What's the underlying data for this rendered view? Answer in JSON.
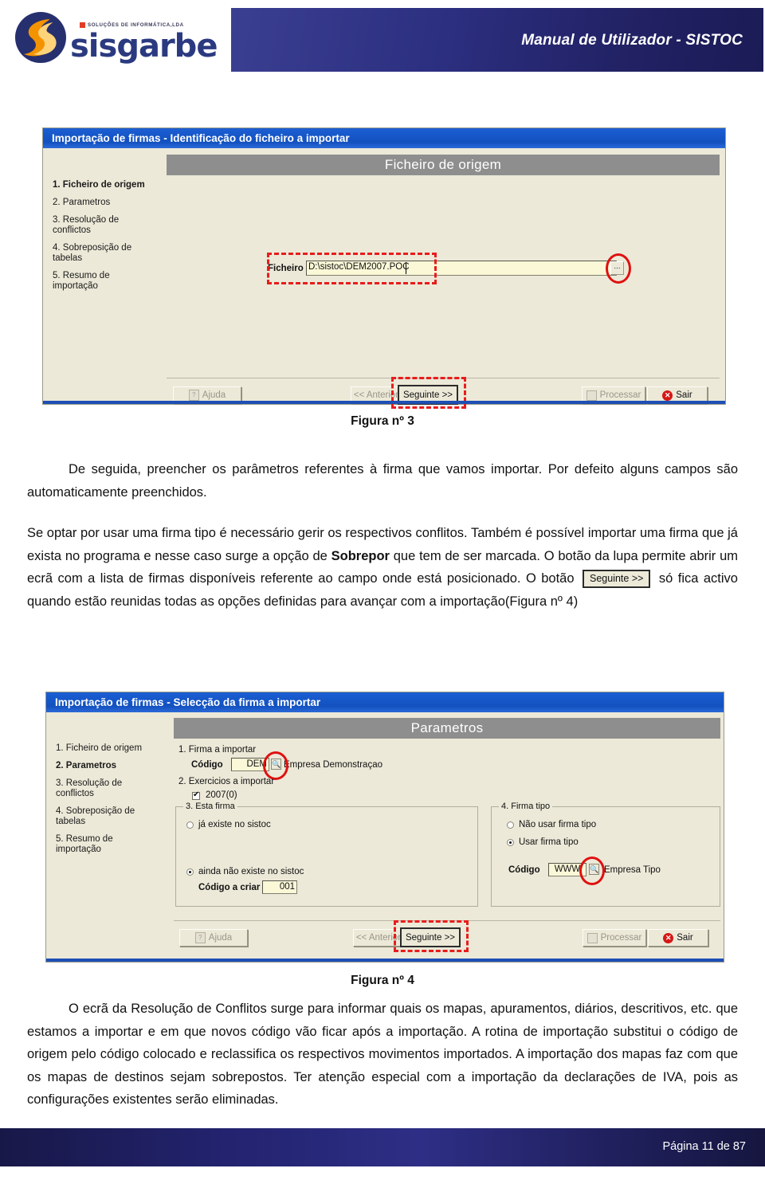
{
  "header": {
    "logo_text": "sisgarbe",
    "logo_tagline": "SOLUÇÕES DE INFORMÁTICA,LDA",
    "title": "Manual de Utilizador - SISTOC"
  },
  "figure3": {
    "caption": "Figura nº 3",
    "window": {
      "title": "Importação de firmas - Identificação do ficheiro a importar",
      "panel_header": "Ficheiro de origem",
      "steps": [
        {
          "label": "1. Ficheiro de origem",
          "active": true
        },
        {
          "label": "2. Parametros",
          "active": false
        },
        {
          "label": "3. Resolução de\nconflictos",
          "active": false
        },
        {
          "label": "4. Sobreposição de\ntabelas",
          "active": false
        },
        {
          "label": "5. Resumo de\nimportação",
          "active": false
        }
      ],
      "file_field": {
        "label": "Ficheiro",
        "value": "D:\\sistoc\\DEM2007.POC",
        "browse_label": "..."
      },
      "buttons": {
        "ajuda": "Ajuda",
        "anterior": "<< Anterior",
        "seguinte": "Seguinte >>",
        "processar": "Processar",
        "sair": "Sair"
      }
    }
  },
  "figure4": {
    "caption": "Figura nº 4",
    "window": {
      "title": "Importação de firmas - Selecção da firma a importar",
      "panel_header": "Parametros",
      "steps": [
        {
          "label": "1. Ficheiro de origem",
          "active": false
        },
        {
          "label": "2. Parametros",
          "active": true
        },
        {
          "label": "3. Resolução de\nconflictos",
          "active": false
        },
        {
          "label": "4. Sobreposição de\ntabelas",
          "active": false
        },
        {
          "label": "5. Resumo de\nimportação",
          "active": false
        }
      ],
      "section1": {
        "legend": "1. Firma a importar",
        "codigo_label": "Código",
        "codigo_value": "DEM",
        "firma_name": "Empresa Demonstraçao"
      },
      "section2": {
        "legend": "2. Exercicios a importar",
        "exercise_label": "2007(0)",
        "exercise_checked": true
      },
      "section3": {
        "legend": "3. Esta firma",
        "opt_existe": "já existe no sistoc",
        "opt_nao_existe": "ainda não existe no sistoc",
        "selected": "ainda não existe no sistoc",
        "codigo_criar_label": "Código a criar",
        "codigo_criar_value": "001"
      },
      "section4": {
        "legend": "4. Firma tipo",
        "opt_nao_usar": "Não usar firma tipo",
        "opt_usar": "Usar firma tipo",
        "selected": "Usar firma tipo",
        "codigo_label": "Código",
        "codigo_value": "WWW",
        "tipo_name": "Empresa Tipo"
      },
      "buttons": {
        "ajuda": "Ajuda",
        "anterior": "<< Anterior",
        "seguinte": "Seguinte >>",
        "processar": "Processar",
        "sair": "Sair"
      }
    }
  },
  "body": {
    "para1": "De seguida, preencher os parâmetros referentes à firma que vamos importar. Por defeito alguns campos são automaticamente preenchidos.",
    "para2_a": "Se optar por usar uma firma tipo é necessário gerir os respectivos conflitos. Também é possível importar uma firma que já exista no programa e nesse caso surge a opção de ",
    "para2_bold": "Sobrepor",
    "para2_b": " que tem de ser marcada. O botão da lupa permite abrir um ecrã com a lista de firmas disponíveis referente ao campo onde está posicionado. O botão ",
    "para2_inline_button": "Seguinte >>",
    "para2_c": " só fica activo quando estão reunidas todas as opções definidas para avançar com a importação(Figura nº 4)",
    "para3": "O ecrã da Resolução de Conflitos surge para informar quais os mapas, apuramentos, diários, descritivos, etc. que estamos a importar e em que novos código vão ficar após a importação. A rotina de importação substitui o código de origem pelo código colocado e reclassifica os respectivos movimentos importados. A importação dos mapas faz com que os mapas de destinos sejam sobrepostos. Ter atenção especial com a importação da declarações de IVA, pois as configurações existentes serão eliminadas."
  },
  "footer": {
    "page_text": "Página 11 de 87"
  }
}
